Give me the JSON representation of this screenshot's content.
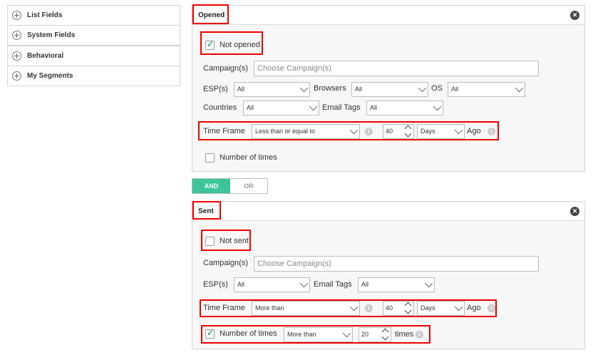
{
  "sidebar": {
    "items": [
      {
        "label": "List Fields"
      },
      {
        "label": "System Fields"
      },
      {
        "label": "Behavioral"
      },
      {
        "label": "My Segments"
      }
    ]
  },
  "opened": {
    "title": "Opened",
    "not_opened_label": "Not opened",
    "not_opened_checked": true,
    "campaigns_label": "Campaign(s)",
    "campaigns_placeholder": "Choose Campaign(s)",
    "esp_label": "ESP(s)",
    "esp_value": "All",
    "browsers_label": "Browsers",
    "browsers_value": "All",
    "os_label": "OS",
    "os_value": "All",
    "countries_label": "Countries",
    "countries_value": "All",
    "email_tags_label": "Email Tags",
    "email_tags_value": "All",
    "timeframe_label": "Time Frame",
    "timeframe_op": "Less than or equal to",
    "timeframe_num": "40",
    "timeframe_unit": "Days",
    "timeframe_suffix": "Ago",
    "num_times_label": "Number of times",
    "num_times_checked": false
  },
  "logic": {
    "and_label": "AND",
    "or_label": "OR",
    "selected": "AND"
  },
  "sent": {
    "title": "Sent",
    "not_sent_label": "Not sent",
    "not_sent_checked": false,
    "campaigns_label": "Campaign(s)",
    "campaigns_placeholder": "Choose Campaign(s)",
    "esp_label": "ESP(s)",
    "esp_value": "All",
    "email_tags_label": "Email Tags",
    "email_tags_value": "All",
    "timeframe_label": "Time Frame",
    "timeframe_op": "More than",
    "timeframe_num": "40",
    "timeframe_unit": "Days",
    "timeframe_suffix": "Ago",
    "num_times_label": "Number of times",
    "num_times_checked": true,
    "num_times_op": "More than",
    "num_times_value": "20",
    "num_times_suffix": "times"
  },
  "colors": {
    "accent": "#3ec49a",
    "highlight": "#e00000"
  }
}
